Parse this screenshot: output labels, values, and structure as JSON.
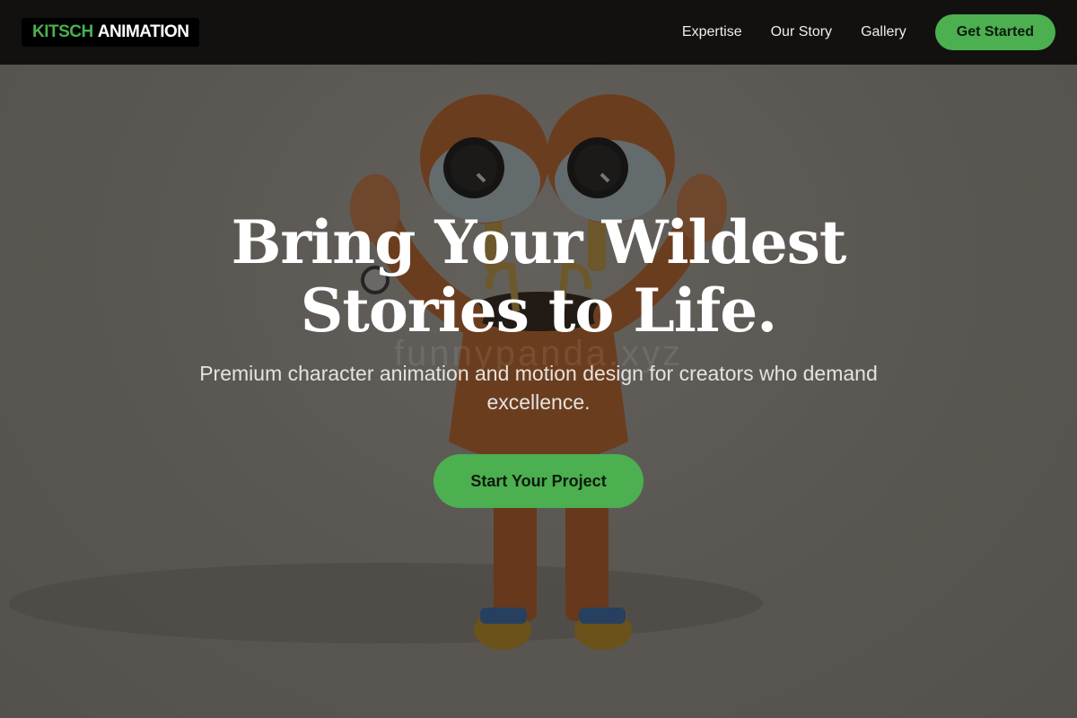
{
  "nav": {
    "logo_accent": "KITSCH",
    "logo_main": "ANIMATION",
    "links": [
      "Expertise",
      "Our Story",
      "Gallery"
    ],
    "cta_label": "Get Started"
  },
  "hero": {
    "title_line1": "Bring Your Wildest",
    "title_line2": "Stories to Life.",
    "subtitle": "Premium character animation and motion design for creators who demand excellence.",
    "cta_label": "Start Your Project",
    "watermark": "funnypanda.xyz"
  },
  "colors": {
    "accent": "#4caf50",
    "nav_bg": "#121110",
    "character_orange": "#e0702a"
  }
}
